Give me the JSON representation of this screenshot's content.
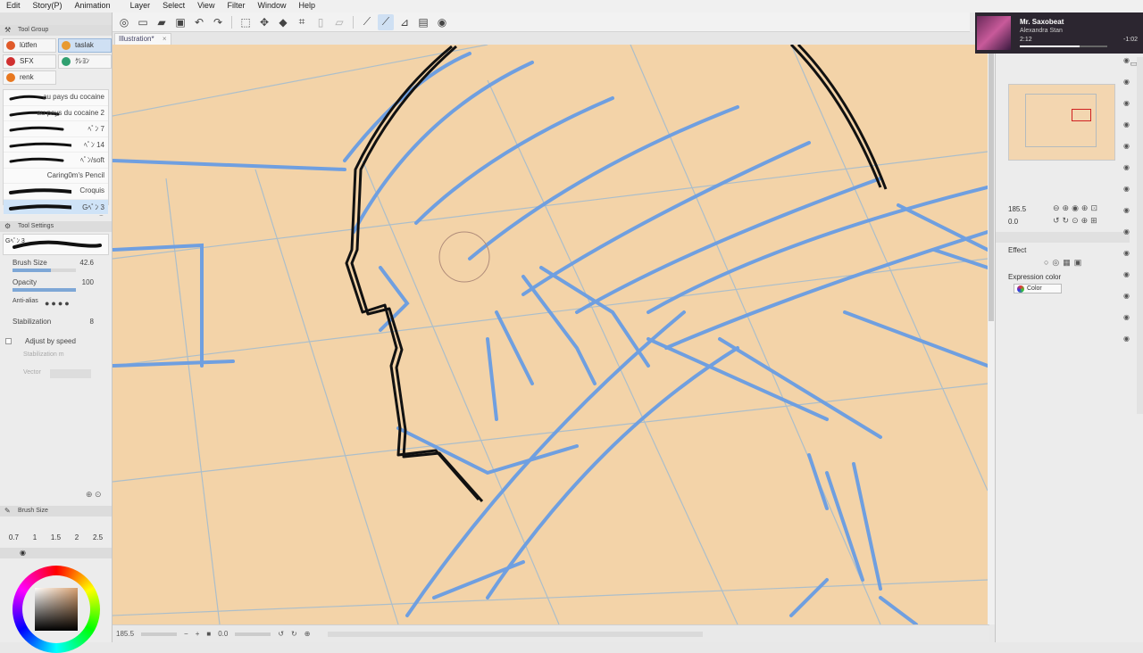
{
  "menu": [
    "Edit",
    "Story(P)",
    "Animation",
    "Layer",
    "Select",
    "View",
    "Filter",
    "Window",
    "Help"
  ],
  "document_tab": {
    "name": "Illustration*",
    "close": "×"
  },
  "tool_group": {
    "title": "Tool Group",
    "groups": [
      {
        "label": "lütfen",
        "color": "#e05a2a",
        "active": false
      },
      {
        "label": "taslak",
        "color": "#e89a30",
        "active": true
      },
      {
        "label": "SFX",
        "color": "#d03030",
        "active": false
      },
      {
        "label": "ｸﾚﾖﾝ",
        "color": "#30a070",
        "active": false
      },
      {
        "label": "renk",
        "color": "#e87820",
        "active": false
      }
    ]
  },
  "brushes": [
    {
      "name": "au pays du cocaine",
      "selected": false
    },
    {
      "name": "au pays du cocaine 2",
      "selected": false
    },
    {
      "name": "ﾍﾟﾝ 7",
      "selected": false
    },
    {
      "name": "ﾍﾟﾝ 14",
      "selected": false
    },
    {
      "name": "ﾍﾟﾝ/soft",
      "selected": false
    },
    {
      "name": "Caring0m's Pencil",
      "selected": false
    },
    {
      "name": "Croquis",
      "selected": false
    },
    {
      "name": "Gﾍﾟﾝ 3",
      "selected": true
    }
  ],
  "tool_settings": {
    "title": "Tool Settings",
    "current_tool": "Gﾍﾟﾝ 3",
    "brush_size_label": "Brush Size",
    "brush_size": "42.6",
    "brush_size_fraction": 0.6,
    "opacity_label": "Opacity",
    "opacity": "100",
    "opacity_fraction": 1.0,
    "antialias_label": "Anti-alias",
    "stabilization_label": "Stabilization",
    "stabilization": "8",
    "adjust_speed_label": "Adjust by speed",
    "stabilization_mode_label": "Stabilization m",
    "vector_label": "Vector"
  },
  "brush_size_panel": {
    "title": "Brush Size",
    "sizes": [
      "0.7",
      "1",
      "1.5",
      "2",
      "2.5"
    ]
  },
  "status": {
    "zoom": "185.5",
    "angle": "0.0"
  },
  "navigator": {
    "zoom": "185.5",
    "angle": "0.0"
  },
  "layer_property": {
    "effect_label": "Effect",
    "expression_label": "Expression color",
    "expression_value": "Color"
  },
  "media": {
    "title": "Mr. Saxobeat",
    "artist": "Alexandra Stan",
    "elapsed": "2:12",
    "remaining": "-1:02",
    "progress": 0.68
  },
  "colors": {
    "canvas": "#f3d3a8",
    "sketch_blue": "#6f9fe0",
    "ink": "#111111",
    "accent": "#cfe3f7"
  }
}
